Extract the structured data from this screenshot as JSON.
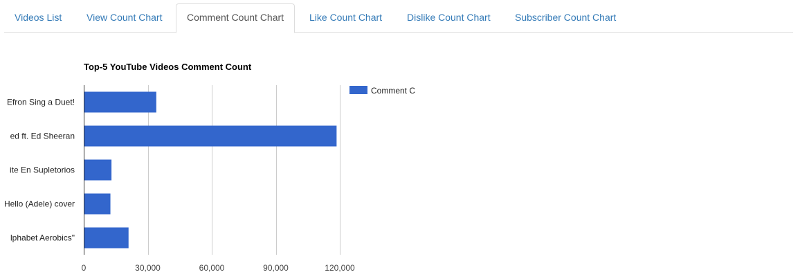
{
  "tabs": [
    {
      "label": "Videos List",
      "active": false
    },
    {
      "label": "View Count Chart",
      "active": false
    },
    {
      "label": "Comment Count Chart",
      "active": true
    },
    {
      "label": "Like Count Chart",
      "active": false
    },
    {
      "label": "Dislike Count Chart",
      "active": false
    },
    {
      "label": "Subscriber Count Chart",
      "active": false
    }
  ],
  "colors": {
    "bar": "#3366cc",
    "gridline": "#cccccc",
    "axis": "#333333",
    "tab_link": "#337ab7"
  },
  "chart_data": {
    "type": "bar",
    "orientation": "horizontal",
    "title": "Top-5 YouTube Videos Comment Count",
    "categories": [
      "Efron Sing a Duet!",
      "ed ft. Ed Sheeran",
      "ite En Supletorios",
      "Hello (Adele) cover",
      "lphabet Aerobics\""
    ],
    "series": [
      {
        "name": "Comment C",
        "values": [
          34000,
          118500,
          13000,
          12500,
          21000
        ]
      }
    ],
    "xticks": [
      "0",
      "30,000",
      "60,000",
      "90,000",
      "120,000"
    ],
    "xlim": [
      0,
      120000
    ],
    "grid": true,
    "legend": "right"
  }
}
